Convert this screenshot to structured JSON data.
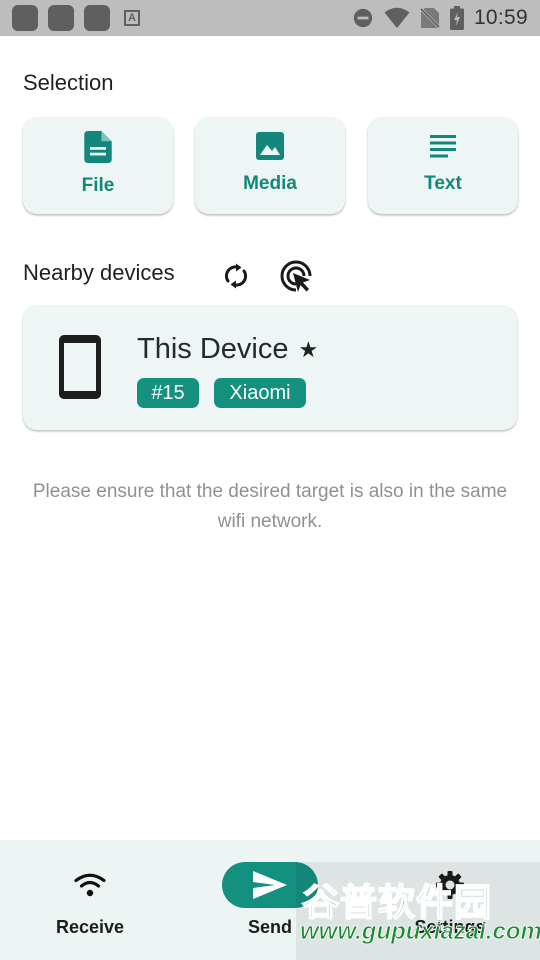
{
  "status_bar": {
    "time": "10:59",
    "notification_icons": [
      "app-icon",
      "app-icon",
      "app-icon",
      "a-letter-icon"
    ],
    "notification_letter": "A",
    "system_icons": [
      "do-not-disturb-icon",
      "wifi-signal-icon",
      "no-sim-icon",
      "battery-charging-icon"
    ]
  },
  "selection": {
    "title": "Selection",
    "buttons": [
      {
        "label": "File",
        "icon": "file-icon"
      },
      {
        "label": "Media",
        "icon": "image-icon"
      },
      {
        "label": "Text",
        "icon": "text-lines-icon"
      }
    ]
  },
  "nearby": {
    "title": "Nearby devices",
    "refresh_icon": "refresh-icon",
    "scan_icon": "target-cursor-icon"
  },
  "device": {
    "name": "This Device",
    "star": "★",
    "tags": [
      "#15",
      "Xiaomi"
    ],
    "icon": "smartphone-icon"
  },
  "hint": "Please ensure that the desired target is also in the same wifi network.",
  "bottom_nav": {
    "items": [
      {
        "label": "Receive",
        "icon": "wifi-icon",
        "selected": false
      },
      {
        "label": "Send",
        "icon": "send-icon",
        "selected": true
      },
      {
        "label": "Settings",
        "icon": "gear-icon",
        "selected": false
      }
    ]
  },
  "watermark": {
    "line1": "谷普软件园",
    "line2": "www.gupuxiazai.com"
  },
  "colors": {
    "accent": "#13877c",
    "tag_bg": "#14907f",
    "card_bg": "#eef6f5",
    "nav_bg": "#edf5f4",
    "status_bar": "#bdbdbd"
  }
}
